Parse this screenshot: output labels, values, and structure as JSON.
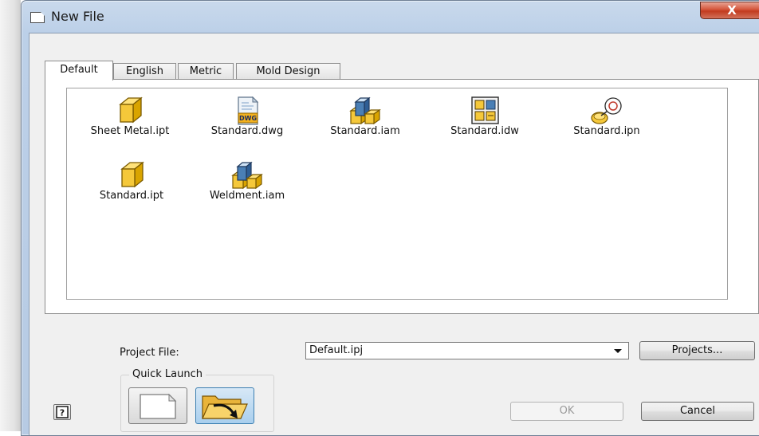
{
  "window": {
    "title": "New File",
    "close_label": "X",
    "title_icon": "document-icon"
  },
  "tabs": [
    {
      "label": "Default",
      "active": true
    },
    {
      "label": "English",
      "active": false
    },
    {
      "label": "Metric",
      "active": false
    },
    {
      "label": "Mold Design",
      "active": false
    }
  ],
  "files": [
    {
      "label": "Sheet Metal.ipt",
      "icon": "part-icon"
    },
    {
      "label": "Standard.dwg",
      "icon": "dwg-icon"
    },
    {
      "label": "Standard.iam",
      "icon": "assembly-icon"
    },
    {
      "label": "Standard.idw",
      "icon": "drawing-icon"
    },
    {
      "label": "Standard.ipn",
      "icon": "presentation-icon"
    },
    {
      "label": "Standard.ipt",
      "icon": "part-icon"
    },
    {
      "label": "Weldment.iam",
      "icon": "assembly-icon"
    }
  ],
  "project": {
    "label": "Project File:",
    "selected": "Default.ipj",
    "projects_button": "Projects..."
  },
  "quick_launch": {
    "label": "Quick Launch",
    "items": [
      {
        "icon": "new-document-icon"
      },
      {
        "icon": "open-folder-icon"
      }
    ]
  },
  "buttons": {
    "ok": "OK",
    "cancel": "Cancel",
    "help_icon": "help-icon"
  },
  "colors": {
    "title_bar": "#bcd0e8",
    "close_button": "#c23b1f",
    "dialog_body": "#f0f0f0",
    "icon_yellow": "#f5c83a",
    "icon_blue": "#4a7fb5"
  }
}
